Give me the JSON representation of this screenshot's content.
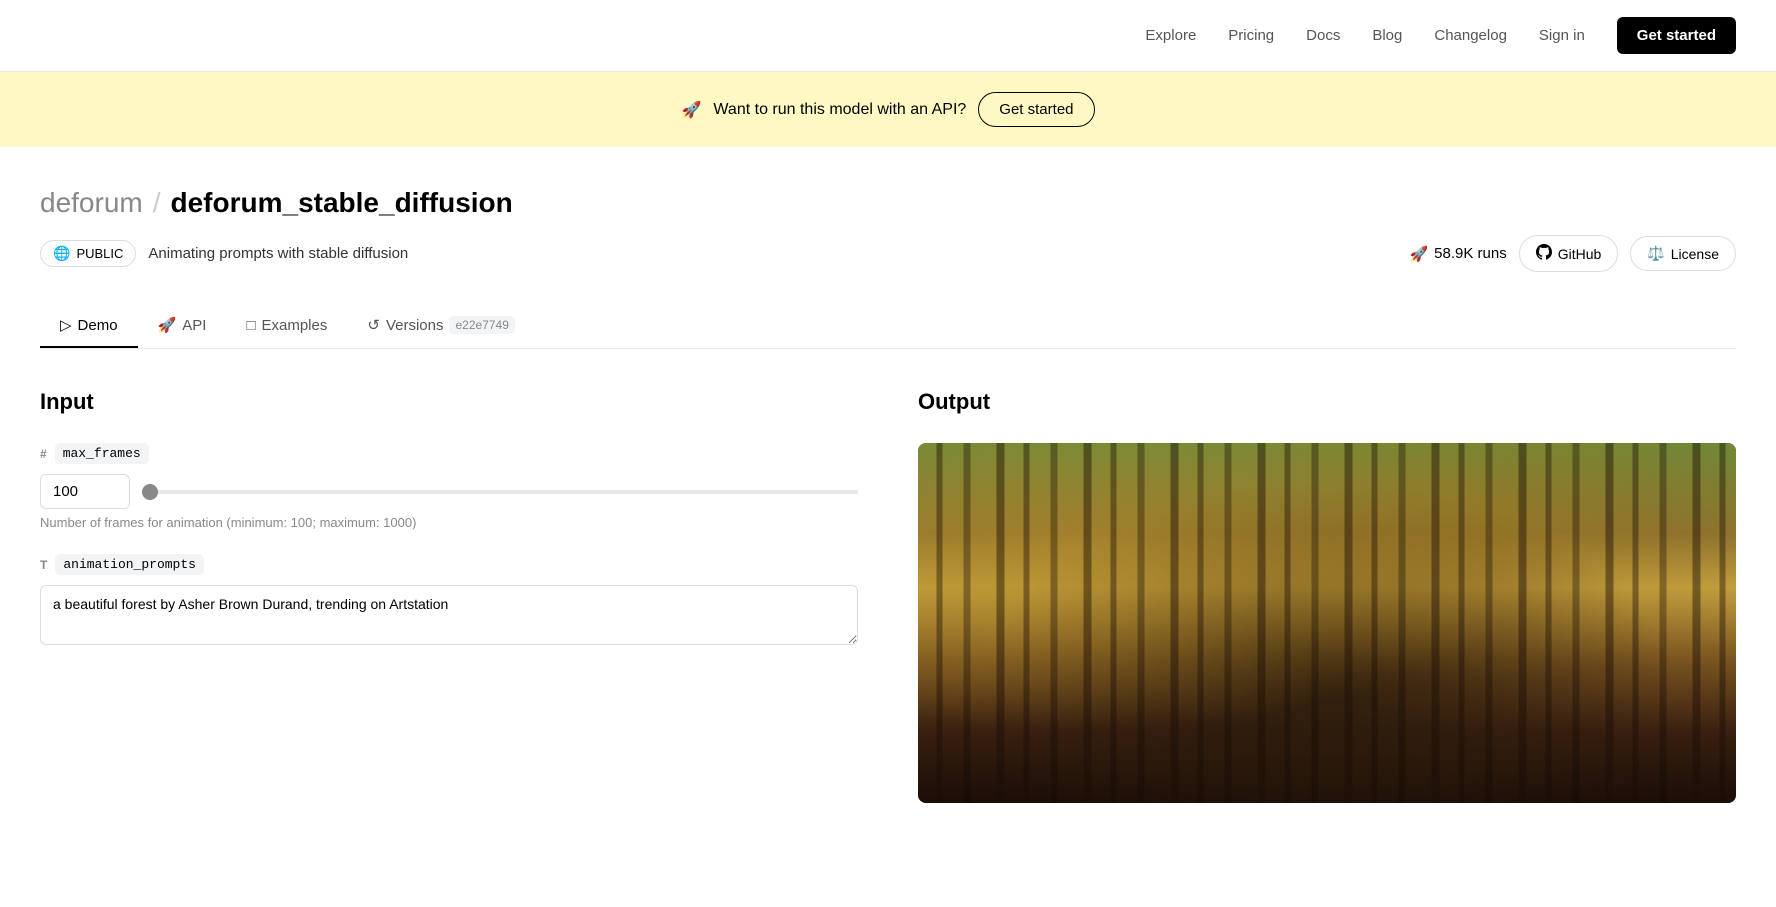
{
  "nav": {
    "logo_symbol": "⊢",
    "links": [
      {
        "label": "Explore",
        "id": "explore"
      },
      {
        "label": "Pricing",
        "id": "pricing"
      },
      {
        "label": "Docs",
        "id": "docs"
      },
      {
        "label": "Blog",
        "id": "blog"
      },
      {
        "label": "Changelog",
        "id": "changelog"
      },
      {
        "label": "Sign in",
        "id": "signin"
      }
    ],
    "cta_label": "Get started"
  },
  "banner": {
    "emoji": "🚀",
    "text": "Want to run this model with an API?",
    "cta_label": "Get started"
  },
  "page": {
    "namespace": "deforum",
    "slash": "/",
    "model_name": "deforum_stable_diffusion",
    "visibility": "PUBLIC",
    "description": "Animating prompts with stable diffusion",
    "runs_count": "58.9K runs",
    "github_label": "GitHub",
    "license_label": "License"
  },
  "tabs": [
    {
      "label": "Demo",
      "icon": "play-icon",
      "id": "demo",
      "active": true
    },
    {
      "label": "API",
      "icon": "api-icon",
      "id": "api",
      "active": false
    },
    {
      "label": "Examples",
      "icon": "examples-icon",
      "id": "examples",
      "active": false
    },
    {
      "label": "Versions",
      "icon": "versions-icon",
      "id": "versions",
      "active": false,
      "version_tag": "e22e7749"
    }
  ],
  "input": {
    "section_title": "Input",
    "fields": [
      {
        "type": "#",
        "name": "max_frames",
        "value": "100",
        "description": "Number of frames for animation (minimum: 100; maximum: 1000)",
        "input_type": "number_slider",
        "min": 100,
        "max": 1000,
        "slider_percent": 0
      },
      {
        "type": "T",
        "name": "animation_prompts",
        "value": "a beautiful forest by Asher Brown Durand, trending on Artstation",
        "input_type": "textarea"
      }
    ]
  },
  "output": {
    "section_title": "Output",
    "image_alt": "A beautiful forest animation frame - dark trees with golden atmospheric light"
  }
}
